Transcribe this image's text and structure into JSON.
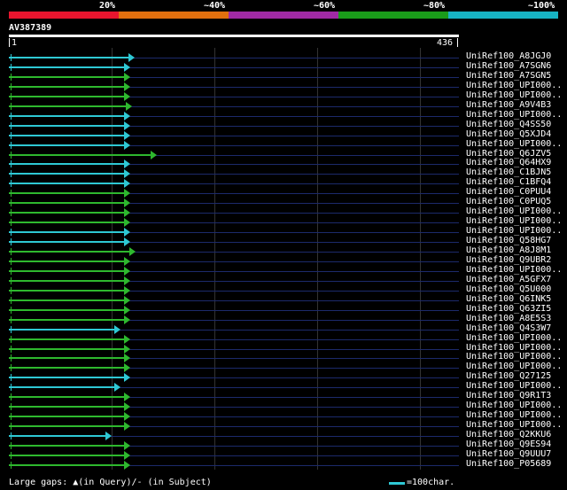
{
  "legend": {
    "segments": [
      {
        "color": "#e8152e"
      },
      {
        "color": "#e2700e"
      },
      {
        "color": "#a02aa5"
      },
      {
        "color": "#1a9c1a"
      },
      {
        "color": "#17b3c3"
      }
    ],
    "labels": [
      "20%",
      "~40%",
      "~60%",
      "~80%",
      "~100%"
    ]
  },
  "query": {
    "title": "AV387389",
    "start": "1",
    "end": "436"
  },
  "colors": {
    "cyan": "#2ec8d4",
    "green": "#2eb82e",
    "grid": "#1c2a6b"
  },
  "hits": [
    {
      "label": "UniRef100_A8JGJ0",
      "color": "cyan",
      "len": 0.265
    },
    {
      "label": "UniRef100_A7SGN6",
      "color": "cyan",
      "len": 0.255
    },
    {
      "label": "UniRef100_A7SGN5",
      "color": "green",
      "len": 0.255
    },
    {
      "label": "UniRef100_UPI000..",
      "color": "green",
      "len": 0.255
    },
    {
      "label": "UniRef100_UPI000..",
      "color": "green",
      "len": 0.255
    },
    {
      "label": "UniRef100_A9V4B3",
      "color": "green",
      "len": 0.26
    },
    {
      "label": "UniRef100_UPI000..",
      "color": "cyan",
      "len": 0.255
    },
    {
      "label": "UniRef100_Q4SS50",
      "color": "cyan",
      "len": 0.255
    },
    {
      "label": "UniRef100_Q5XJD4",
      "color": "cyan",
      "len": 0.255
    },
    {
      "label": "UniRef100_UPI000..",
      "color": "cyan",
      "len": 0.255
    },
    {
      "label": "UniRef100_Q6JZV5",
      "color": "green",
      "len": 0.315
    },
    {
      "label": "UniRef100_Q64HX9",
      "color": "cyan",
      "len": 0.255
    },
    {
      "label": "UniRef100_C1BJN5",
      "color": "cyan",
      "len": 0.255
    },
    {
      "label": "UniRef100_C1BFQ4",
      "color": "cyan",
      "len": 0.255
    },
    {
      "label": "UniRef100_C0PUU4",
      "color": "green",
      "len": 0.255
    },
    {
      "label": "UniRef100_C0PUQ5",
      "color": "green",
      "len": 0.255
    },
    {
      "label": "UniRef100_UPI000..",
      "color": "green",
      "len": 0.255
    },
    {
      "label": "UniRef100_UPI000..",
      "color": "green",
      "len": 0.255
    },
    {
      "label": "UniRef100_UPI000..",
      "color": "cyan",
      "len": 0.255
    },
    {
      "label": "UniRef100_Q58HG7",
      "color": "cyan",
      "len": 0.255
    },
    {
      "label": "UniRef100_A8J8M1",
      "color": "green",
      "len": 0.268
    },
    {
      "label": "UniRef100_Q9UBR2",
      "color": "green",
      "len": 0.255
    },
    {
      "label": "UniRef100_UPI000..",
      "color": "green",
      "len": 0.255
    },
    {
      "label": "UniRef100_A5GFX7",
      "color": "green",
      "len": 0.255
    },
    {
      "label": "UniRef100_Q5U000",
      "color": "green",
      "len": 0.255
    },
    {
      "label": "UniRef100_Q6INK5",
      "color": "green",
      "len": 0.255
    },
    {
      "label": "UniRef100_Q63ZI5",
      "color": "green",
      "len": 0.255
    },
    {
      "label": "UniRef100_A8E5S3",
      "color": "green",
      "len": 0.255
    },
    {
      "label": "UniRef100_Q4S3W7",
      "color": "cyan",
      "len": 0.235
    },
    {
      "label": "UniRef100_UPI000..",
      "color": "green",
      "len": 0.255
    },
    {
      "label": "UniRef100_UPI000..",
      "color": "green",
      "len": 0.255
    },
    {
      "label": "UniRef100_UPI000..",
      "color": "green",
      "len": 0.255
    },
    {
      "label": "UniRef100_UPI000..",
      "color": "green",
      "len": 0.255
    },
    {
      "label": "UniRef100_Q27125",
      "color": "cyan",
      "len": 0.255
    },
    {
      "label": "UniRef100_UPI000..",
      "color": "cyan",
      "len": 0.235
    },
    {
      "label": "UniRef100_Q9R1T3",
      "color": "green",
      "len": 0.255
    },
    {
      "label": "UniRef100_UPI000..",
      "color": "green",
      "len": 0.255
    },
    {
      "label": "UniRef100_UPI000..",
      "color": "green",
      "len": 0.255
    },
    {
      "label": "UniRef100_UPI000..",
      "color": "green",
      "len": 0.255
    },
    {
      "label": "UniRef100_Q2KKU6",
      "color": "cyan",
      "len": 0.215
    },
    {
      "label": "UniRef100_Q9ES94",
      "color": "green",
      "len": 0.255
    },
    {
      "label": "UniRef100_Q9UUU7",
      "color": "green",
      "len": 0.255
    },
    {
      "label": "UniRef100_P05689",
      "color": "green",
      "len": 0.255
    }
  ],
  "footer": {
    "gaps_text": "Large gaps: ▲(in Query)/- (in Subject)",
    "scale_text": "=100char."
  }
}
